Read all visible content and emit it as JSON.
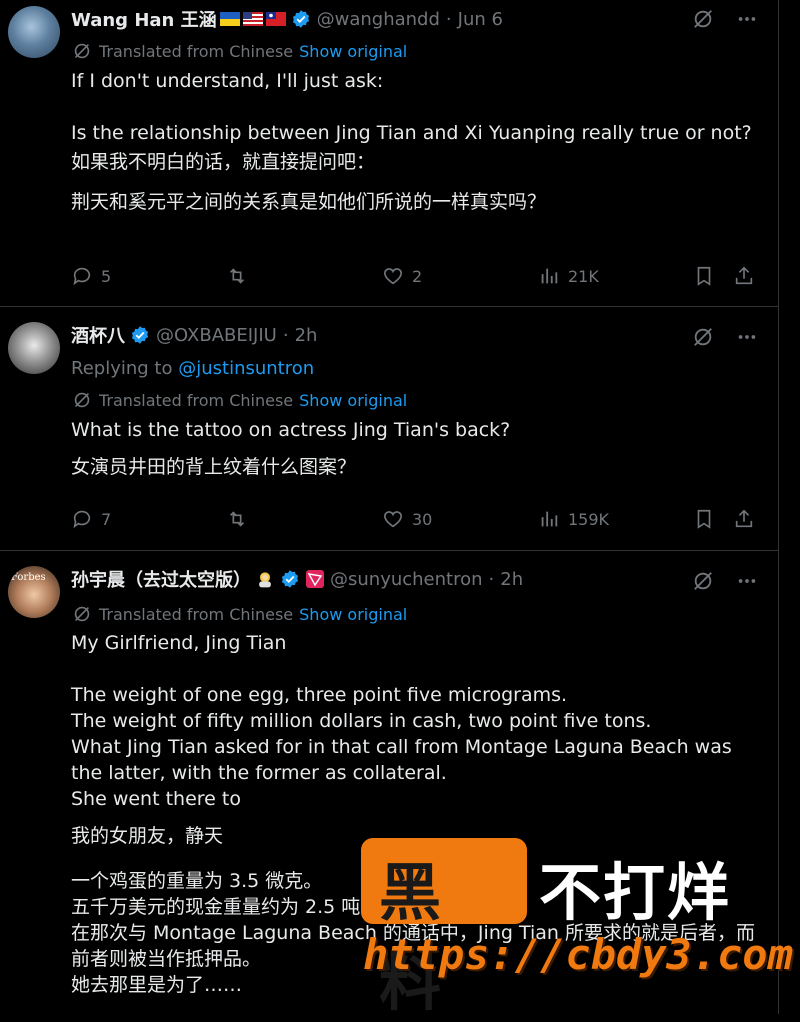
{
  "tweets": [
    {
      "name": "Wang Han 王涵",
      "handle": "@wanghandd",
      "sep": "·",
      "time": "Jun 6",
      "translated_label": "Translated from Chinese",
      "show_original": "Show original",
      "body_en_1": "If I don't understand, I'll just ask:",
      "body_en_2": "Is the relationship between Jing Tian and Xi Yuanping really true or not?",
      "body_zh_1": "如果我不明白的话，就直接提问吧：",
      "body_zh_2": "荆天和奚元平之间的关系真是如他们所说的一样真实吗？",
      "replies": "5",
      "retweets": "",
      "likes": "2",
      "views": "21K"
    },
    {
      "name": "酒杯八",
      "handle": "@OXBABEIJIU",
      "sep": "·",
      "time": "2h",
      "replying_label": "Replying to",
      "replying_to": "@justinsuntron",
      "translated_label": "Translated from Chinese",
      "show_original": "Show original",
      "body_en_1": "What is the tattoo on actress Jing Tian's back?",
      "body_zh_1": "女演员井田的背上纹着什么图案？",
      "replies": "7",
      "retweets": "",
      "likes": "30",
      "views": "159K"
    },
    {
      "name": "孙宇晨（去过太空版）",
      "handle": "@sunyuchentron",
      "sep": "·",
      "time": "2h",
      "translated_label": "Translated from Chinese",
      "show_original": "Show original",
      "body_en_1": "My Girlfriend, Jing Tian",
      "body_en_2": "The weight of one egg, three point five micrograms.",
      "body_en_3": "The weight of fifty million dollars in cash, two point five tons.",
      "body_en_4": "What Jing Tian asked for in that call from Montage Laguna Beach was the latter, with the former as collateral.",
      "body_en_5": "She went there to",
      "body_zh_1": "我的女朋友，静天",
      "body_zh_2": "一个鸡蛋的重量为 3.5 微克。",
      "body_zh_3": "五千万美元的现金重量约为 2.5 吨",
      "body_zh_4": "在那次与 Montage Laguna Beach 的通话中，Jing Tian 所要求的就是后者，而",
      "body_zh_5": "前者则被当作抵押品。",
      "body_zh_6": "她去那里是为了……",
      "avatar_text": "Forbes"
    }
  ],
  "watermark": {
    "black_text": "黑料",
    "white_text": "不打烊",
    "url": "https://cbdy3.com"
  },
  "colors": {
    "background": "#000000",
    "text": "#e7e9ea",
    "muted": "#71767b",
    "link": "#1d9bf0",
    "divider": "#2f3336",
    "watermark_orange": "#f07a0f"
  }
}
